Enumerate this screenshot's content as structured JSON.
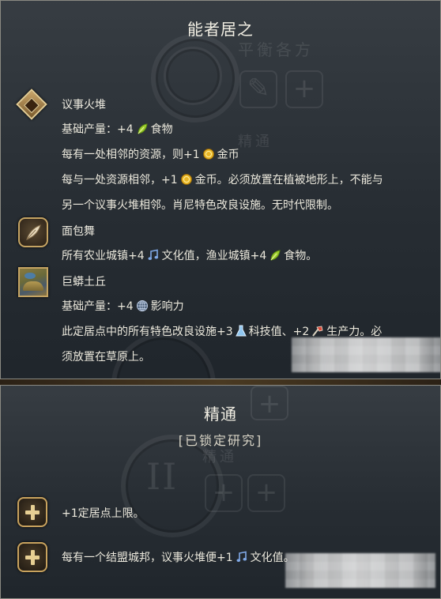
{
  "top_panel": {
    "title": "能者居之",
    "bg_ghost_title": "平衡各方",
    "bg_ghost_label": "精通",
    "entries": [
      {
        "name": "议事火堆",
        "icon": "campfire-icon",
        "lines": [
          {
            "parts": [
              "基础产量：+4",
              "食物"
            ],
            "icons": [
              "food-icon"
            ]
          },
          {
            "parts": [
              "每有一处相邻的资源，则+1",
              "金币"
            ],
            "icons": [
              "gold-icon"
            ]
          },
          {
            "parts": [
              "每与一处资源相邻，+1",
              "金币。必须放置在植被地形上，不能与"
            ],
            "icons": [
              "gold-icon"
            ]
          },
          {
            "parts": [
              "另一个议事火堆相邻。肖尼特色改良设施。无时代限制。"
            ],
            "icons": []
          }
        ]
      },
      {
        "name": "面包舞",
        "icon": "feather-icon",
        "lines": [
          {
            "parts": [
              "所有农业城镇+4",
              "文化值，渔业城镇+4",
              "食物。"
            ],
            "icons": [
              "culture-icon",
              "food-icon"
            ]
          }
        ]
      },
      {
        "name": "巨蟒土丘",
        "icon": "serpent-mound-icon",
        "lines": [
          {
            "parts": [
              "基础产量：+4",
              "影响力"
            ],
            "icons": [
              "influence-icon"
            ]
          },
          {
            "parts": [
              "此定居点中的所有特色改良设施+3",
              "科技值、+2",
              "生产力。必"
            ],
            "icons": [
              "science-icon",
              "production-icon"
            ]
          },
          {
            "parts": [
              "须放置在草原上。"
            ],
            "icons": []
          }
        ]
      }
    ]
  },
  "bottom_panel": {
    "title": "精通",
    "subtitle": "[已锁定研究]",
    "bg_ghost_roman": "II",
    "bg_ghost_label": "精通",
    "entries": [
      {
        "parts": [
          "+1定居点上限。"
        ],
        "icons": []
      },
      {
        "parts": [
          "每有一个结盟城邦，议事火堆便+1",
          "文化值。"
        ],
        "icons": [
          "culture-icon"
        ]
      }
    ]
  },
  "colors": {
    "panel_border": "#8b8a82",
    "text": "#ebe8dc",
    "gold_frame": "#c9a35e",
    "food": "#9fcf2f",
    "gold": "#e8b526",
    "culture": "#7fa8e6",
    "science": "#8fc6f0",
    "production": "#d94a3a",
    "influence": "#8fa9cc"
  }
}
